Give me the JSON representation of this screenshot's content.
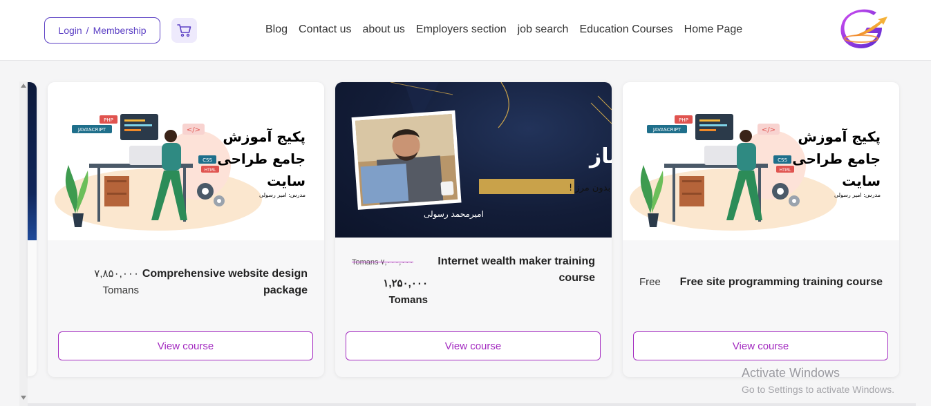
{
  "header": {
    "login_label": "Login",
    "separator": "/",
    "membership_label": "Membership",
    "cart_icon": "shopping-cart-icon",
    "nav": [
      "Blog",
      "Contact us",
      "about us",
      "Employers section",
      "job search",
      "Education Courses",
      "Home Page"
    ],
    "logo_icon": "brand-logo-icon"
  },
  "colors": {
    "accent": "#5b3fc4",
    "button_border": "#a32ac0",
    "cart_bg": "#eeeafc"
  },
  "cards": [
    {
      "title_line1": "Comprehensive website design",
      "title_line2": "package",
      "price_value": "۷,۸۵۰,۰۰۰",
      "price_unit": "Tomans",
      "button": "View course",
      "image": {
        "fa_line1": "پکیج آموزش",
        "fa_line2": "جامع طراحی",
        "fa_line3": "سایت",
        "fa_small": "مدرس: امیر رسولی",
        "tags": [
          "PHP",
          "JAVASCRIPT",
          "CSS",
          "HTML",
          "</>"
        ]
      }
    },
    {
      "title_line1": "Internet wealth maker training",
      "title_line2": "course",
      "old_price": "Tomans ۷,۰۰۰,۰۰۰",
      "price_value": "۱,۲۵۰,۰۰۰",
      "price_unit": "Tomans",
      "button": "View course",
      "image": {
        "fa_title": "اینترنت ثروت ساز",
        "fa_subtitle": "پولسازی بدون مرز !",
        "fa_name": "امیرمحمد رسولی"
      }
    },
    {
      "title_line1": "Free site programming training course",
      "price_value": "Free",
      "button": "View course",
      "image": {
        "fa_line1": "پکیج آموزش",
        "fa_line2": "جامع طراحی",
        "fa_line3": "سایت",
        "fa_small": "مدرس: امیر رسولی",
        "tags": [
          "PHP",
          "JAVASCRIPT",
          "CSS",
          "HTML",
          "</>"
        ]
      }
    }
  ],
  "watermark": {
    "line1": "Activate Windows",
    "line2": "Go to Settings to activate Windows."
  }
}
